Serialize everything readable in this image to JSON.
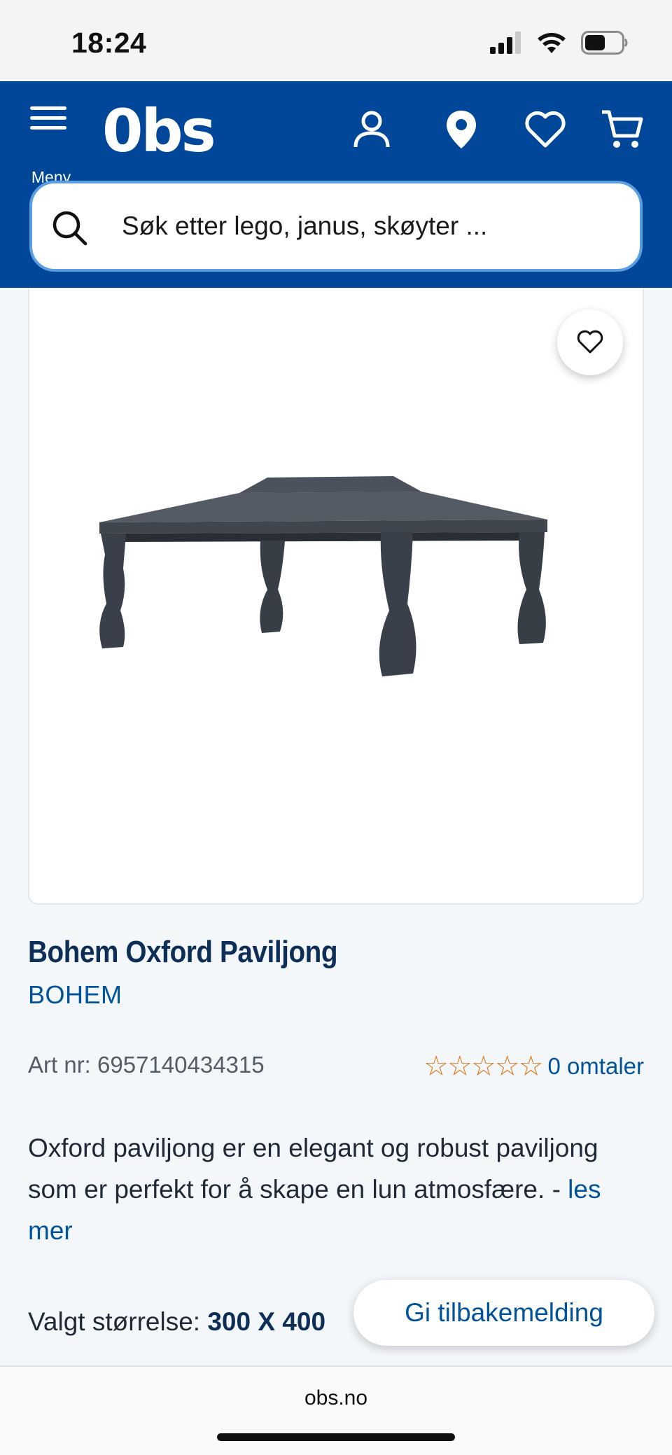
{
  "status_bar": {
    "time": "18:24",
    "battery_icon": "battery-icon",
    "wifi_icon": "wifi-icon",
    "signal_icon": "signal-icon"
  },
  "header": {
    "menu_label": "Meny",
    "logo_text": "0bs",
    "search_placeholder": "Søk etter lego, janus, skøyter ..."
  },
  "product": {
    "title": "Bohem Oxford Paviljong",
    "brand": "BOHEM",
    "art_nr": "Art nr: 6957140434315",
    "stars": "☆☆☆☆☆",
    "rating_value": 0,
    "reviews": "0 omtaler",
    "description": "Oxford paviljong er en elegant og robust paviljong som er perfekt for å skape en lun atmosfære. - ",
    "read_more": "les mer",
    "size_label": "Valgt størrelse: ",
    "size_value": "300 X 400"
  },
  "feedback_button": "Gi tilbakemelding",
  "browser": {
    "url": "obs.no"
  },
  "colors": {
    "brand_blue": "#004799",
    "link_blue": "#00539b",
    "star_orange": "#e07a1f"
  }
}
